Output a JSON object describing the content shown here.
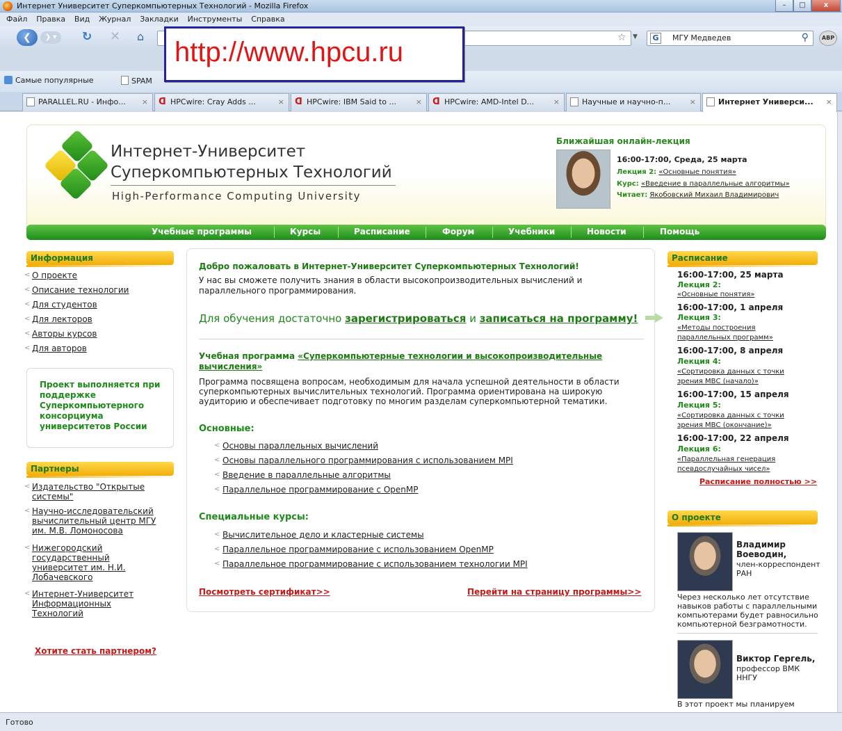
{
  "window": {
    "title": "Интернет Университет Суперкомпьютерных Технологий - Mozilla Firefox",
    "buttons": {
      "minimize": "–",
      "maximize": "□",
      "close": "x"
    }
  },
  "menu": [
    "Файл",
    "Правка",
    "Вид",
    "Журнал",
    "Закладки",
    "Инструменты",
    "Справка"
  ],
  "search": {
    "value": "МГУ Медведев",
    "engine_letter": "G"
  },
  "url_overlay": "http://www.hpcu.ru",
  "addon": "ABP",
  "bookmarks": [
    "Самые популярные",
    "SPAM"
  ],
  "tabs": [
    "PARALLEL.RU - Инфо...",
    "HPCwire: Cray Adds ...",
    "HPCwire: IBM Said to ...",
    "HPCwire: AMD-Intel D...",
    "Научные и научно-п...",
    "Интернет Универси..."
  ],
  "header": {
    "brand_line1": "Интернет-Университет",
    "brand_line2": "Суперкомпьютерных Технологий",
    "brand_line3": "High-Performance Computing University",
    "lecture_heading": "Ближайшая онлайн-лекция",
    "lecture_time": "16:00-17:00, Среда, 25 марта",
    "lecture_label": "Лекция 2:",
    "lecture_link": "«Основные понятия»",
    "course_label": "Курс:",
    "course_link": "«Введение в параллельные алгоритмы»",
    "reader_label": "Читает:",
    "reader_link": "Якобовский Михаил Владимирович"
  },
  "nav": [
    "Учебные программы",
    "Курсы",
    "Расписание",
    "Форум",
    "Учебники",
    "Новости",
    "Помощь"
  ],
  "left": {
    "info_heading": "Информация",
    "info_links": [
      "О проекте",
      "Описание технологии",
      "Для студентов",
      "Для лекторов",
      "Авторы курсов",
      "Для авторов"
    ],
    "project_text": "Проект выполняется при поддержке Суперкомпьютерного консорциума университетов России",
    "partners_heading": "Партнеры",
    "partners": [
      "Издательство \"Открытые системы\"",
      "Научно-исследовательский вычислительный центр МГУ им. М.В. Ломоносова",
      "Нижегородский государственный университет им. Н.И. Лобачевского",
      "Интернет-Университет Информационных Технологий"
    ],
    "become_partner": "Хотите стать партнером?"
  },
  "center": {
    "welcome_title": "Добро пожаловать в Интернет-Университет Суперкомпьютерных Технологий!",
    "welcome_text": "У нас вы сможете получить знания в области высокопроизводительных вычислений и параллельного программирования.",
    "signup_prefix": "Для обучения достаточно",
    "signup_register": "зарегистрироваться",
    "signup_and": "и",
    "signup_enroll": "записаться на программу!",
    "program_label": "Учебная программа",
    "program_link": "«Суперкомпьютерные технологии и высокопроизводительные вычисления»",
    "program_desc": "Программа посвящена вопросам, необходимым для начала успешной деятельности в области суперкомпьютерных вычислительных технологий. Программа ориентирована на широкую аудиторию и обеспечивает подготовку по многим разделам суперкомпьютерной тематики.",
    "main_heading": "Основные:",
    "main_courses": [
      "Основы параллельных вычислений",
      "Основы параллельного программирования с использованием MPI",
      "Введение в параллельные алгоритмы",
      "Параллельное программирование с OpenMP"
    ],
    "special_heading": "Специальные курсы:",
    "special_courses": [
      "Вычислительное дело и кластерные системы",
      "Параллельное программирование с использованием OpenMP",
      "Параллельное программирование с использованием технологии MPI"
    ],
    "certificate_link": "Посмотреть сертификат>>",
    "program_page_link": "Перейти на страницу программы>>"
  },
  "right": {
    "schedule_heading": "Расписание",
    "schedule": [
      {
        "time": "16:00-17:00, 25 марта",
        "lecture": "Лекция 2:",
        "title_lines": [
          "«Основные понятия»"
        ]
      },
      {
        "time": "16:00-17:00, 1 апреля",
        "lecture": "Лекция 3:",
        "title_lines": [
          "«Методы построения",
          "параллельных программ»"
        ]
      },
      {
        "time": "16:00-17:00, 8 апреля",
        "lecture": "Лекция 4:",
        "title_lines": [
          "«Сортировка данных с точки",
          "зрения МВС (начало)»"
        ]
      },
      {
        "time": "16:00-17:00, 15 апреля",
        "lecture": "Лекция 5:",
        "title_lines": [
          "«Сортировка данных с точки",
          "зрения МВС (окончание)»"
        ]
      },
      {
        "time": "16:00-17:00, 22 апреля",
        "lecture": "Лекция 6:",
        "title_lines": [
          "«Параллельная генерация",
          "псевдослучайных чисел»"
        ]
      }
    ],
    "full_schedule": "Расписание полностью >>",
    "about_heading": "О проекте",
    "person1": {
      "name_lines": [
        "Владимир",
        "Воеводин,"
      ],
      "role_lines": [
        "член-корреспондент",
        "РАН"
      ],
      "quote_lines": [
        "Через несколько лет отсутствие",
        "навыков работы с параллельными",
        "компьютерами будет равносильно",
        "компьютерной безграмотности."
      ]
    },
    "person2": {
      "name_lines": [
        "Виктор Гергель,"
      ],
      "role_lines": [
        "профессор ВМК",
        "ННГУ"
      ],
      "quote_lines": [
        "В этот проект мы планируем"
      ]
    }
  },
  "status": "Готово",
  "colors": {
    "accent_green": "#1e8a1a",
    "nav_green": "#3aa82c",
    "heading_yellow": "#f7c525",
    "link_red": "#c51a1a"
  }
}
